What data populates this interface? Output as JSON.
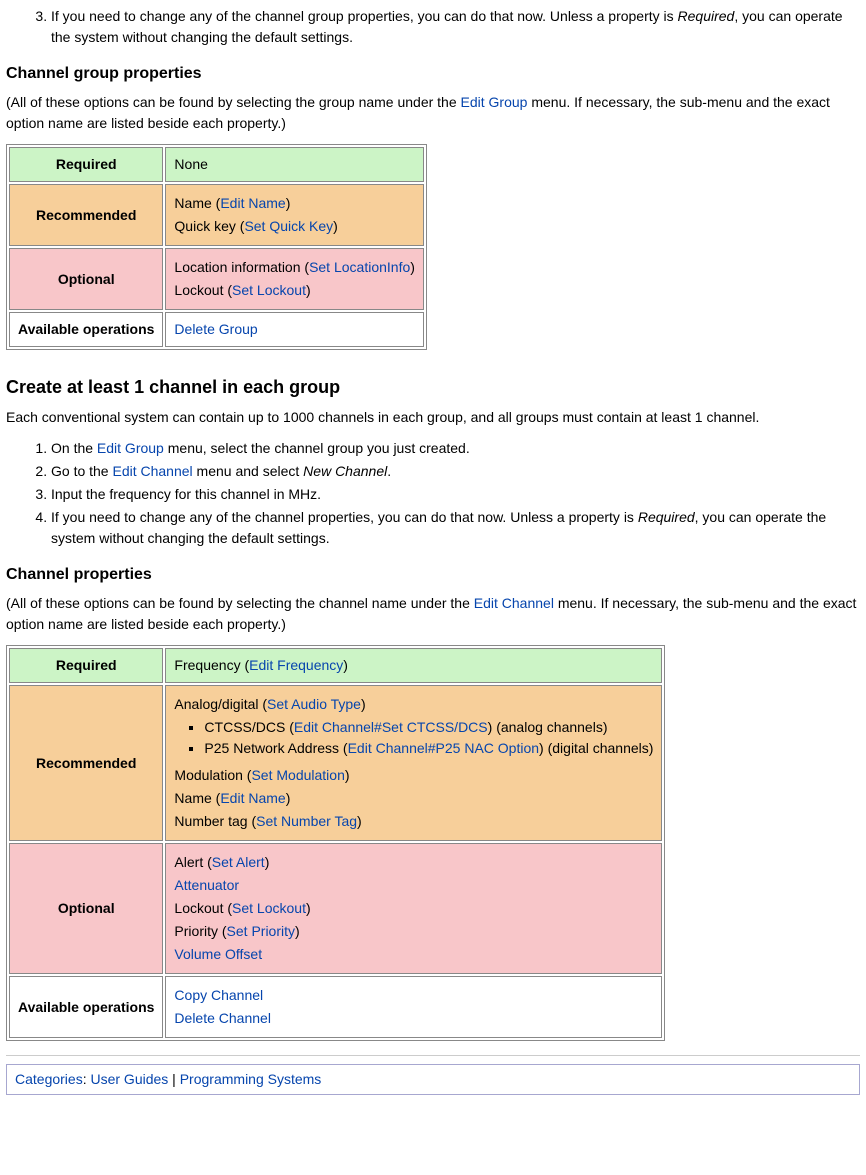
{
  "step3": {
    "prefix": "3.",
    "text_a": "If you need to change any of the ",
    "text_b": "channel group properties",
    "text_c": ", you can do that now. Unless a property is ",
    "text_d": "Required",
    "text_e": ", you can operate the system without changing the default settings."
  },
  "groupProps": {
    "heading": "Channel group properties",
    "intro_a": "(All of these options can be found by selecting the group name under the ",
    "intro_link": "Edit Group",
    "intro_b": " menu. If necessary, the sub-menu and the exact option name are listed beside each property.)",
    "rows": {
      "required": {
        "label": "Required",
        "content": "None"
      },
      "recommended": {
        "label": "Recommended",
        "name_text": "Name (",
        "name_link": "Edit Name",
        "name_close": ")",
        "qk_text": "Quick key (",
        "qk_link": "Set Quick Key",
        "qk_close": ")"
      },
      "optional": {
        "label": "Optional",
        "loc_text": "Location information (",
        "loc_link": "Set LocationInfo",
        "loc_close": ")",
        "lock_text": "Lockout (",
        "lock_link": "Set Lockout",
        "lock_close": ")"
      },
      "ops": {
        "label": "Available operations",
        "op1": "Delete Group"
      }
    }
  },
  "create": {
    "heading": "Create at least 1 channel in each group",
    "intro": "Each conventional system can contain up to 1000 channels in each group, and all groups must contain at least 1 channel.",
    "s1a": "On the ",
    "s1link": "Edit Group",
    "s1b": " menu, select the channel group you just created.",
    "s2a": "Go to the ",
    "s2link": "Edit Channel",
    "s2b": " menu and select ",
    "s2i": "New Channel",
    "s2c": ".",
    "s3": "Input the frequency for this channel in MHz.",
    "s4a": "If you need to change any of the channel properties, you can do that now. Unless a property is ",
    "s4i": "Required",
    "s4b": ", you can operate the system without changing the default settings."
  },
  "chanProps": {
    "heading": "Channel properties",
    "intro_a": "(All of these options can be found by selecting the channel name under the ",
    "intro_link": "Edit Channel",
    "intro_b": " menu. If necessary, the sub-menu and the exact option name are listed beside each property.)",
    "required": {
      "label": "Required",
      "freq_text": "Frequency (",
      "freq_link": "Edit Frequency",
      "freq_close": ")"
    },
    "recommended": {
      "label": "Recommended",
      "ad_text": "Analog/digital (",
      "ad_link": "Set Audio Type",
      "ad_close": ")",
      "ctc_text": "CTCSS/DCS (",
      "ctc_link": "Edit Channel#Set CTCSS/DCS",
      "ctc_close": ") (analog channels)",
      "p25_text": "P25 Network Address (",
      "p25_link": "Edit Channel#P25 NAC Option",
      "p25_close": ") (digital channels)",
      "mod_text": "Modulation (",
      "mod_link": "Set Modulation",
      "mod_close": ")",
      "name_text": "Name (",
      "name_link": "Edit Name",
      "name_close": ")",
      "num_text": "Number tag (",
      "num_link": "Set Number Tag",
      "num_close": ")"
    },
    "optional": {
      "label": "Optional",
      "alert_text": "Alert (",
      "alert_link": "Set Alert",
      "alert_close": ")",
      "atten": "Attenuator",
      "lock_text": "Lockout (",
      "lock_link": "Set Lockout",
      "lock_close": ")",
      "prio_text": "Priority (",
      "prio_link": "Set Priority",
      "prio_close": ")",
      "vol": "Volume Offset"
    },
    "ops": {
      "label": "Available operations",
      "op1": "Copy Channel",
      "op2": "Delete Channel"
    }
  },
  "cats": {
    "label": "Categories",
    "sep": ": ",
    "c1": "User Guides",
    "pipe": " | ",
    "c2": "Programming Systems"
  }
}
